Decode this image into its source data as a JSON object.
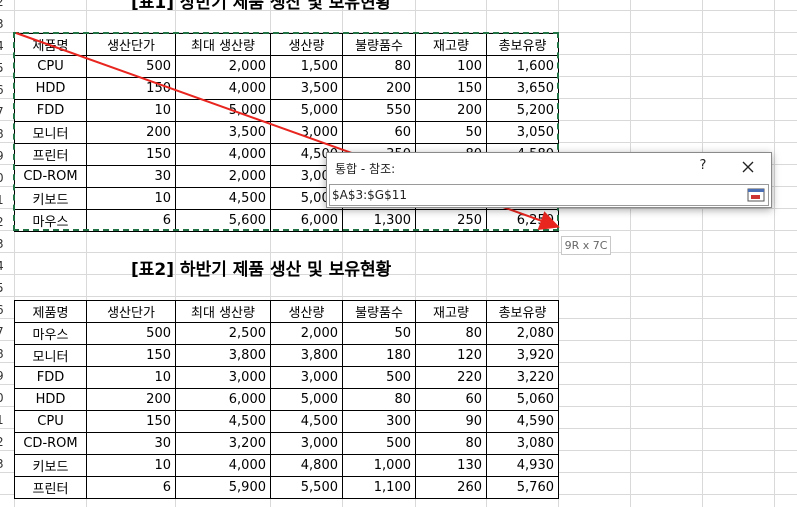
{
  "sheet": {
    "top_title_partial": "[표1] 상반기 제품 생산 및 보유현황",
    "title2": "[표2] 하반기 제품 생산 및 보유현황",
    "row_numbers": [
      "2",
      "3",
      "4",
      "5",
      "6",
      "7",
      "8",
      "9",
      "0",
      "1",
      "2",
      "3",
      "4",
      "5",
      "6",
      "7",
      "8",
      "9",
      "0",
      "1",
      "2",
      "3"
    ]
  },
  "table1": {
    "headers": [
      "제품명",
      "생산단가",
      "최대 생산량",
      "생산량",
      "불량품수",
      "재고량",
      "총보유량"
    ],
    "rows": [
      [
        "CPU",
        "500",
        "2,000",
        "1,500",
        "80",
        "100",
        "1,600"
      ],
      [
        "HDD",
        "150",
        "4,000",
        "3,500",
        "200",
        "150",
        "3,650"
      ],
      [
        "FDD",
        "10",
        "5,000",
        "5,000",
        "550",
        "200",
        "5,200"
      ],
      [
        "모니터",
        "200",
        "3,500",
        "3,000",
        "60",
        "50",
        "3,050"
      ],
      [
        "프린터",
        "150",
        "4,000",
        "4,500",
        "350",
        "80",
        "4,580"
      ],
      [
        "CD-ROM",
        "30",
        "2,000",
        "3,000",
        "",
        "",
        ""
      ],
      [
        "키보드",
        "10",
        "4,500",
        "5,000",
        "",
        "",
        ""
      ],
      [
        "마우스",
        "6",
        "5,600",
        "6,000",
        "1,300",
        "250",
        "6,250"
      ]
    ]
  },
  "table2": {
    "headers": [
      "제품명",
      "생산단가",
      "최대 생산량",
      "생산량",
      "불량품수",
      "재고량",
      "총보유량"
    ],
    "rows": [
      [
        "마우스",
        "500",
        "2,500",
        "2,000",
        "50",
        "80",
        "2,080"
      ],
      [
        "모니터",
        "150",
        "3,800",
        "3,800",
        "180",
        "120",
        "3,920"
      ],
      [
        "FDD",
        "10",
        "3,000",
        "3,000",
        "500",
        "220",
        "3,220"
      ],
      [
        "HDD",
        "200",
        "6,000",
        "5,000",
        "80",
        "60",
        "5,060"
      ],
      [
        "CPU",
        "150",
        "4,500",
        "4,500",
        "300",
        "90",
        "4,590"
      ],
      [
        "CD-ROM",
        "30",
        "3,200",
        "3,000",
        "500",
        "80",
        "3,080"
      ],
      [
        "키보드",
        "10",
        "4,000",
        "4,800",
        "1,000",
        "130",
        "4,930"
      ],
      [
        "프린터",
        "6",
        "5,900",
        "5,500",
        "1,100",
        "260",
        "5,760"
      ]
    ]
  },
  "dialog": {
    "title": "통합 - 참조:",
    "help_label": "?",
    "close_label": "✕",
    "reference_value": "$A$3:$G$11"
  },
  "tooltip": {
    "text": "9R x 7C"
  },
  "colors": {
    "arrow": "#e8251f",
    "selection": "#217346",
    "grid": "#d9d9d9"
  }
}
